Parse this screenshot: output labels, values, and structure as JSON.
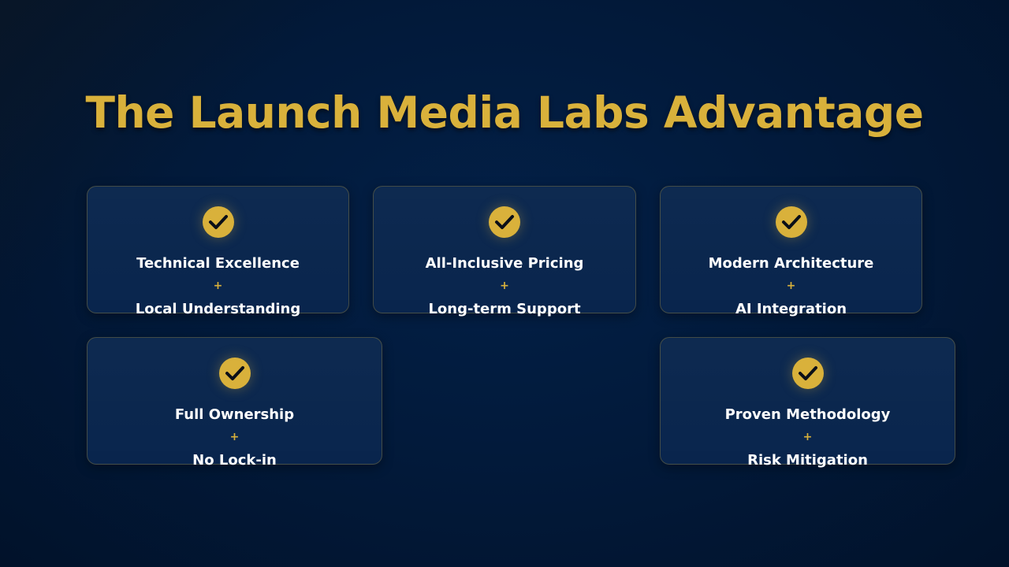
{
  "title": "The Launch Media Labs Advantage",
  "accent_color": "#d9b13b",
  "background_color": "#021a3b",
  "cards": [
    {
      "icon": "check-circle-icon",
      "line1": "Technical Excellence",
      "plus": "+",
      "line2": "Local Understanding"
    },
    {
      "icon": "check-circle-icon",
      "line1": "All-Inclusive Pricing",
      "plus": "+",
      "line2": "Long-term Support"
    },
    {
      "icon": "check-circle-icon",
      "line1": "Modern Architecture",
      "plus": "+",
      "line2": "AI Integration"
    },
    {
      "icon": "check-circle-icon",
      "line1": "Full Ownership",
      "plus": "+",
      "line2": "No Lock-in"
    },
    {
      "icon": "check-circle-icon",
      "line1": "Proven Methodology",
      "plus": "+",
      "line2": "Risk Mitigation"
    }
  ]
}
